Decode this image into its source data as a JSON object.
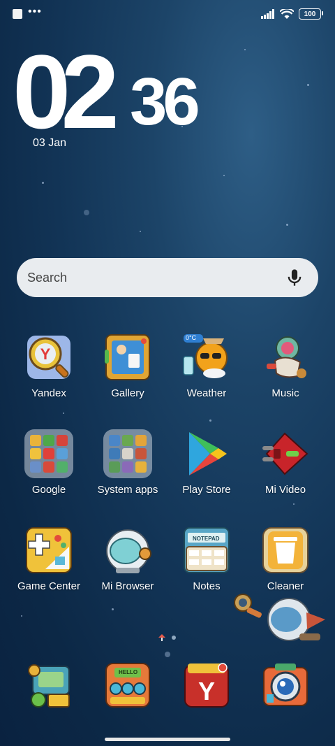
{
  "status_bar": {
    "battery": "100"
  },
  "clock": {
    "hour": "02",
    "minute": "36",
    "date": "03 Jan"
  },
  "search": {
    "placeholder": "Search"
  },
  "apps": [
    {
      "label": "Yandex",
      "icon": "yandex-magnifier-icon"
    },
    {
      "label": "Gallery",
      "icon": "gallery-frame-icon"
    },
    {
      "label": "Weather",
      "icon": "weather-sun-icon",
      "badge": "0°C"
    },
    {
      "label": "Music",
      "icon": "music-astronaut-icon"
    },
    {
      "label": "Google",
      "icon": "google-folder-icon"
    },
    {
      "label": "System apps",
      "icon": "system-apps-folder-icon"
    },
    {
      "label": "Play Store",
      "icon": "play-store-icon"
    },
    {
      "label": "Mi Video",
      "icon": "mi-video-rocket-icon"
    },
    {
      "label": "Game Center",
      "icon": "game-center-icon"
    },
    {
      "label": "Mi Browser",
      "icon": "mi-browser-helmet-icon"
    },
    {
      "label": "Notes",
      "icon": "notes-notepad-icon",
      "icon_text": "NOTEPAD"
    },
    {
      "label": "Cleaner",
      "icon": "cleaner-trash-icon"
    }
  ],
  "dock": [
    {
      "icon": "phone-device-icon"
    },
    {
      "icon": "messages-hello-icon",
      "icon_text": "HELLO"
    },
    {
      "icon": "yandex-browser-icon"
    },
    {
      "icon": "camera-icon"
    }
  ]
}
